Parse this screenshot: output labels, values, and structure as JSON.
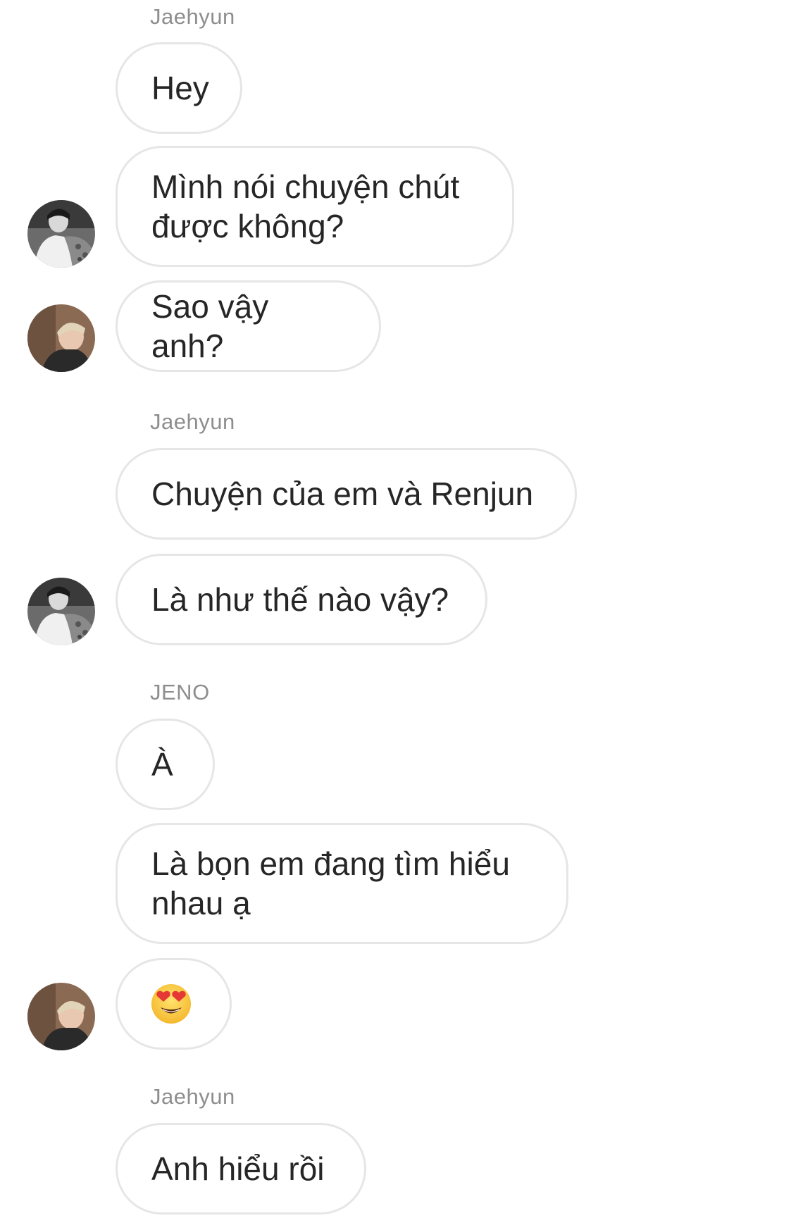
{
  "thread": {
    "sender_1": "Jaehyun",
    "sender_2": "Jaehyun",
    "sender_3": "JENO",
    "sender_4": "Jaehyun",
    "messages": [
      "Hey",
      "Mình nói chuyện chút được không?",
      "Sao vậy anh?",
      "Chuyện của em và Renjun",
      "Là như thế nào vậy?",
      "À",
      "Là bọn em đang tìm hiểu nhau ạ",
      "heart-eyes-emoji",
      "Anh hiểu rồi"
    ]
  },
  "icons": {
    "avatar_1": "jaehyun-avatar",
    "avatar_2": "jeno-avatar",
    "emoji": "smiling-face-with-heart-eyes"
  },
  "colors": {
    "bubble_border": "#e6e6e6",
    "sender_text": "#8e8e8e",
    "message_text": "#262626"
  }
}
